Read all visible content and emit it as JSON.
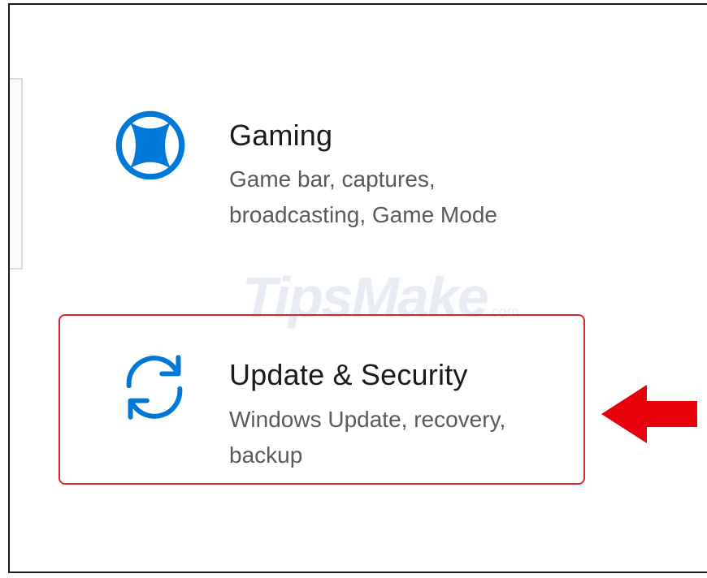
{
  "settings": {
    "tiles": [
      {
        "title": "Gaming",
        "description": "Game bar, captures, broadcasting, Game Mode",
        "icon": "xbox-icon",
        "icon_color": "#0078d7"
      },
      {
        "title": "Update & Security",
        "description": "Windows Update, recovery, backup",
        "icon": "sync-icon",
        "icon_color": "#0078d7",
        "highlighted": true
      }
    ]
  },
  "watermark": {
    "text": "TipsMake",
    "suffix": ".com"
  },
  "annotation": {
    "highlight_color": "#d9262e",
    "arrow_icon": "left-arrow-icon",
    "arrow_color": "#e8000d"
  }
}
